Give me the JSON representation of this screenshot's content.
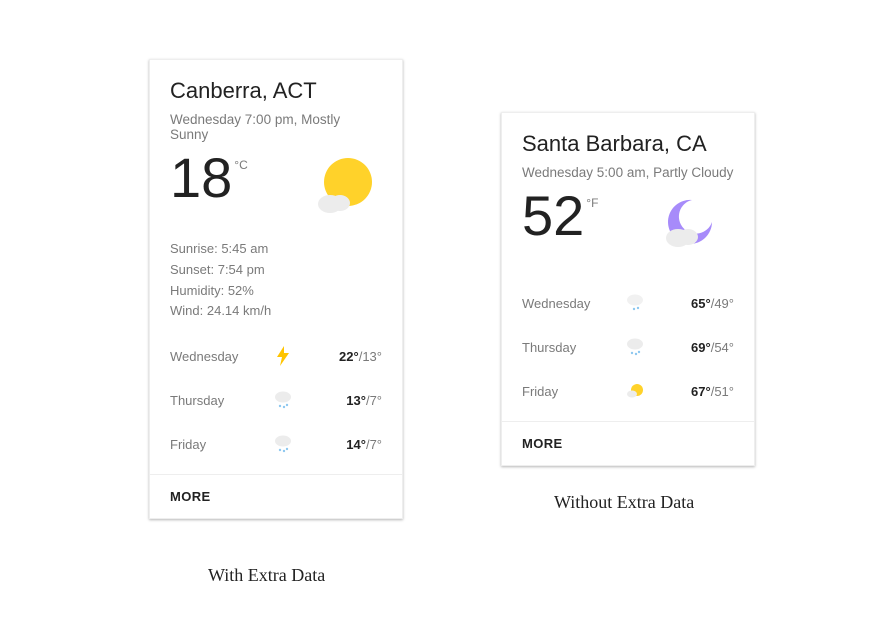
{
  "cards": {
    "left": {
      "location": "Canberra, ACT",
      "time_condition": "Wednesday 7:00 pm, Mostly Sunny",
      "temperature": "18",
      "unit": "°C",
      "icon": "sun-cloud",
      "extra": {
        "sunrise_label": "Sunrise:",
        "sunrise_value": "5:45 am",
        "sunset_label": "Sunset:",
        "sunset_value": "7:54 pm",
        "humidity_label": "Humidity:",
        "humidity_value": "52%",
        "wind_label": "Wind:",
        "wind_value": "24.14 km/h"
      },
      "forecast": [
        {
          "day": "Wednesday",
          "icon": "bolt",
          "hi": "22°",
          "lo": "/13°"
        },
        {
          "day": "Thursday",
          "icon": "rain",
          "hi": "13°",
          "lo": "/7°"
        },
        {
          "day": "Friday",
          "icon": "rain",
          "hi": "14°",
          "lo": "/7°"
        }
      ],
      "more_label": "MORE"
    },
    "right": {
      "location": "Santa Barbara, CA",
      "time_condition": "Wednesday 5:00 am, Partly Cloudy",
      "temperature": "52",
      "unit": "°F",
      "icon": "moon-cloud",
      "forecast": [
        {
          "day": "Wednesday",
          "icon": "rain-light",
          "hi": "65°",
          "lo": "/49°"
        },
        {
          "day": "Thursday",
          "icon": "rain",
          "hi": "69°",
          "lo": "/54°"
        },
        {
          "day": "Friday",
          "icon": "sun-small",
          "hi": "67°",
          "lo": "/51°"
        }
      ],
      "more_label": "MORE"
    }
  },
  "captions": {
    "left": "With Extra Data",
    "right": "Without Extra Data"
  },
  "colors": {
    "sun": "#FFD22A",
    "moon": "#A78BFA",
    "cloud": "#ECECEC",
    "rain": "#8EC8F0",
    "bolt": "#FFC400"
  }
}
